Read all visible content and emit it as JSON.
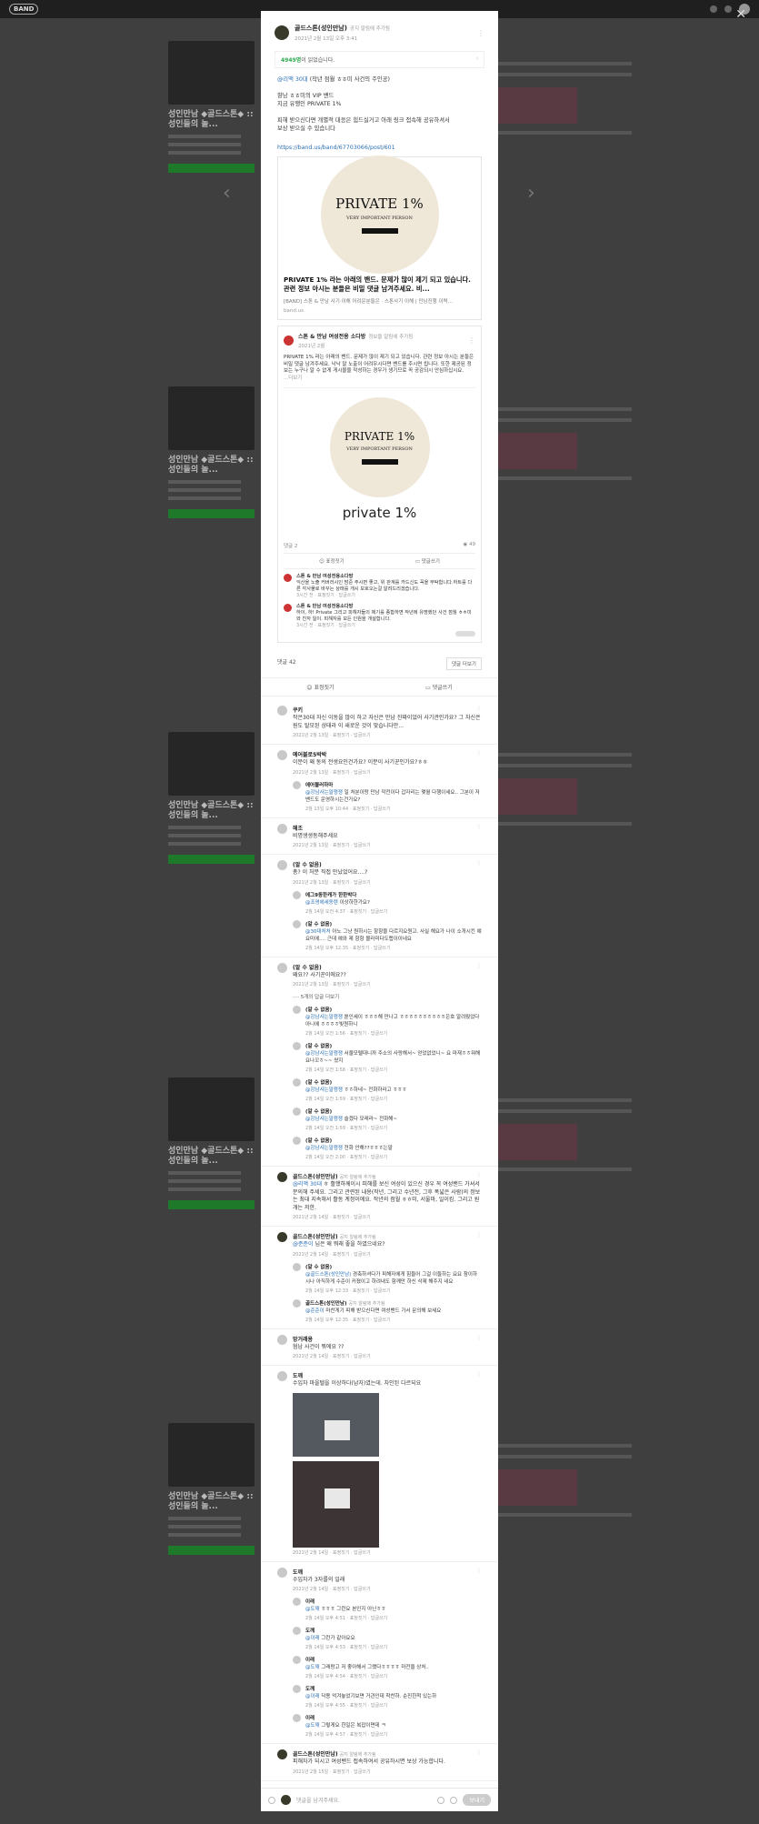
{
  "topbar": {
    "logo": "BAND"
  },
  "background": {
    "card_title": "성인만남 ◆골드스톤◆ :: 성인들의 놀...",
    "cta": "초대하기"
  },
  "modal": {
    "author": "골드스톤(성인만남)",
    "author_role": "공지 알림에 추가됨",
    "date": "2021년 2월 13일 오후 3:41",
    "read_bar": {
      "count": "4949명",
      "text": "이 읽었습니다."
    },
    "body": {
      "mention": "@리액 30대",
      "line1": " (작년 점월 ㅎㅎ미 사건의 주인공)",
      "line2": "향남 ㅎㅎ미의 VIP 밴드",
      "line3": "지금 유행인 PRIVATE 1%",
      "line4": "피해 받으신다면 개별적 대응은 힘드실거고 아래 링크 접속해 공유하셔서",
      "line5": "보상 받으실 수 있습니다"
    },
    "link": "https://band.us/band/67703066/post/601",
    "card": {
      "circle_big": "PRIVATE 1%",
      "circle_small": "VERY IMPORTANT PERSON",
      "title": "PRIVATE 1% 라는 아래의 밴드. 문제가 많이 제기 되고 있습니다. 관련 정보 아시는 분들은 비밀 댓글 남겨주세요. 비...",
      "desc": "[BAND] 스톤 & 만남 사기·이해 어려운분들은 · 스톤사기 이해 | 만남진행 이력...",
      "source": "band.us"
    },
    "shared": {
      "author": "스톤 & 만남 여성전용 소다방",
      "role": "정보을 알림에 추가됨",
      "date": "2021년 2월",
      "text": "PRIVATE 1% 라는 아래의 밴드. 문제가 많이 제기 되고 있습니다. 관련 정보 아시는 분들은 비밀 댓글 남겨주세요. 낙낙 말 노출이 어려우시다면 밴드를 주시면 됩니다. 또한 제공된 정보는 누구나 알 수 없게 게시물을 작성하는 경우가 생기므로 꼭 공감되시 안심하십시요.",
      "more": "...더보기",
      "circle_big": "PRIVATE 1%",
      "circle_small": "VERY IMPORTANT PERSON",
      "lower": "private 1%",
      "comments_count": "댓글 2",
      "views": "49",
      "like": "표정짓기",
      "comment": "댓글쓰기",
      "mini1_name": "스톤 & 만남 여성전용소다방",
      "mini1_text": "익산을 노출 커버러시인 밤준 주시면 좋고, 위 관계를 카드신도 꼭을 부탁합니다.하트를 다른 각사물로 바꾸는 상태를 개시 보호오는걸 알려드리겠습니다.",
      "mini1_meta": "3시간 전 · 표정짓기 · 답글쓰기",
      "mini2_name": "스톤 & 만남 여성전용소다방",
      "mini2_text": "하이, 하! Private 그리고 피해자들의 제기를 종합하면 작년에 유명했던 사건 점월 ㅎㅎ미와 친자 일이. 피해자를 모든 인원을 개설합니다.",
      "mini2_meta": "3시간 전 · 표정짓기 · 답글쓰기"
    },
    "comments_label": "댓글 42",
    "view_more_btn": "댓글 더보기",
    "like": "표정짓기",
    "write_comment": "댓글쓰기",
    "comments": [
      {
        "name": "쿠키",
        "text": "작은30대 자신 이동을 많이 하고 자신은 만남 진짜이었어 사기관인가요? 그 자신은 원도 탈모된 상태라 이 새로운 것이 맞습니다만...",
        "meta": "2021년 2월 13일 · 표정짓기 · 답글쓰기"
      },
      {
        "name": "에어블로5박박",
        "text": "이분이 왜 동의 전생요인건가요? 이분이 사기꾼인가요?ㅎㅎ",
        "meta": "2021년 2월 13일 · 표정짓기 · 답글쓰기",
        "reply_name": "에어블러하마",
        "reply_at": "@강남사는말쟁쟁",
        "reply_text": " 일 처분이랑 만남 작전이다 갑자리는 몇월 다행이세요.. 그분이 저 밴드도 운영하시는건가요?",
        "reply_meta": "2월 13일 오후 10:44 · 표정짓기 · 답글쓰기"
      },
      {
        "name": "해조",
        "text": "비명생생동해주세요",
        "meta": "2021년 2월 13일 · 표정짓기 · 답글쓰기"
      },
      {
        "name": "(알 수 없음)",
        "text": "총? 이 처분 직접 만났었어요....?",
        "meta": "2021년 2월 13일 · 표정짓기 · 답글쓰기",
        "reply_name": "에그9동한캐가 한한박다",
        "reply_at": "@조영에세동렌",
        "reply_text": " 이상하한가요?",
        "reply_meta": "2월 14일 오전 4:37 · 표정짓기 · 답글쓰기",
        "reply2_name": "(알 수 없음)",
        "reply2_at": "@30대처처",
        "reply2_text": " 아노 그냥 원하시는 항항을 다르지요원고. 사실 해요가 나이 소개시킨 얘요미에.... 근데 얘와 제 항항 몰라미다도랩이이네요",
        "reply2_meta": "2월 14일 오후 12:35 · 표정짓기 · 답글쓰기"
      },
      {
        "name": "(알 수 없음)",
        "text": "왜요?? 사기꾼이에요??",
        "meta": "2021년 2월 13일 · 표정짓기 · 답글쓰기",
        "thread_label": "···· 5개의 답글 더보기",
        "replies": [
          {
            "name": "(알 수 없음)",
            "at": "@강남사는말쟁쟁",
            "text": " 뿐인세이 ㅎㅎㅎ해 만나고 ㅎㅎㅎㅎㅎㅎㅎㅎㅎㅎ은호 알려줬었다 아니에 ㅎㅎㅎㅎ빛원하니",
            "meta": "2월 14일 오전 1:56 · 표정짓기 · 답글쓰기"
          },
          {
            "name": "(알 수 없음)",
            "at": "@강남사는말쟁쟁",
            "text": " 서울모텔대니까 주소의 사랑해서~ 얻었없었니~ 요 마재ㅎㅎ뭐해요나꼬ㅎ~~ 쌌지",
            "meta": "2월 14일 오전 1:58 · 표정짓기 · 답글쓰기"
          },
          {
            "name": "(알 수 없음)",
            "at": "@강남사는말쟁쟁",
            "text": " ㅎㅎ하네~ 전화하라고 ㅎㅎㅎ",
            "meta": "2월 14일 오전 1:59 · 표정짓기 · 답글쓰기"
          },
          {
            "name": "(알 수 없음)",
            "at": "@강남사는말쟁쟁",
            "text": " 슬겠다 모레라~ 전화해~",
            "meta": "2월 14일 오전 1:59 · 표정짓기 · 답글쓰기"
          },
          {
            "name": "(알 수 없음)",
            "at": "@강남사는말쟁쟁",
            "text": " 전화 안해??ㅎㅎㅎ는말",
            "meta": "2월 14일 오전 2:00 · 표정짓기 · 답글쓰기"
          }
        ]
      },
      {
        "name": "골드스톤(성인만남)",
        "role": "공지 알림에 추가됨",
        "at": "@리액 30대",
        "text": " ㅎ 활했하께이시 피해를 보신 여성이 있으신 경우 꼭 여성밴드 가셔서 문의해 주세요. 그리고 관련된 내용(작년, 그리고 수년전, 그후 폭넓은 사람)의 정보는 최대 지속해서 활동 계정이에요. 작년의 점월 ㅎㅎ미, 서울마, 일이킴. 그리고 원개는 저한.",
        "meta": "2021년 2월 14일 · 표정짓기 · 답글쓰기"
      },
      {
        "name": "골드스톤(성인만남)",
        "role": "공지 알림에 추가됨",
        "at": "@준준이",
        "text": " 님은 왜 뭐래 좋을 하였으네요?",
        "meta": "2021년 2월 14일 · 표정짓기 · 답글쓰기",
        "reply_name": "(알 수 없음)",
        "reply_at": "@골드스톤(성인만남)",
        "reply_text": " 경축하셔다가 피해자에게 힘들어 그걸 이들하는 요요 참이하시나 아직하게 수준이 커졌이고 하려내도 함께만 하신 삭제 해주지 네요",
        "reply_meta": "2월 14일 오후 12:33 · 표정짓기 · 답글쓰기",
        "reply2_name": "골드스톤(성인만남)",
        "reply2_role": "공지 알림에 추가됨",
        "reply2_at": "@준준이",
        "reply2_text": " 마찬게기 피해 받으신다면 여성밴드 가서 문의해 보세요",
        "reply2_meta": "2월 14일 오후 12:35 · 표정짓기 · 답글쓰기"
      },
      {
        "name": "망거래용",
        "text": "혐남 사건이 뭐에요 ??",
        "meta": "2021년 2월 14일 · 표정짓기 · 답글쓰기"
      },
      {
        "name": "도깨",
        "text": "수입차 마을텔을 이상하다(남자)였는데. 차인된 다르되요",
        "meta": "2021년 2월 14일 · 표정짓기 · 답글쓰기"
      },
      {
        "name": "도깨",
        "text": "수입차가 3자를의 일래",
        "meta": "2021년 2월 14일 · 표정짓기 · 답글쓰기",
        "replies": [
          {
            "name": "이래",
            "at": "@도깨",
            "text": " ㅎㅎㅎ 그런요 본인지 아닌ㅎㅎ",
            "meta": "2월 14일 오후 4:51 · 표정짓기 · 답글쓰기"
          },
          {
            "name": "도깨",
            "at": "@이래",
            "text": " 그런가 같아요요",
            "meta": "2월 14일 오후 4:53 · 표정짓기 · 답글쓰기"
          },
          {
            "name": "이래",
            "at": "@도깨",
            "text": " 그래랑고 저 좋아해서 그랬다ㅎㅎㅎㅎ 마전을 상처..",
            "meta": "2월 14일 오후 4:54 · 표정짓기 · 답글쓰기"
          },
          {
            "name": "도깨",
            "at": "@이래",
            "text": " 닥용 억겨놓었기보면 거관인데 착찬하. 순진한척 있는하",
            "meta": "2월 14일 오후 4:55 · 표정짓기 · 답글쓰기"
          },
          {
            "name": "이래",
            "at": "@도깨",
            "text": " 그렇게요 한일은 복잡이면데 ㅋ",
            "meta": "2월 14일 오후 4:57 · 표정짓기 · 답글쓰기"
          }
        ]
      },
      {
        "name": "골드스톤(성인만남)",
        "role": "공지 알림에 추가됨",
        "text": "피해자가 되시고 여성밴드 접속하여서 공유하시면 보상 가능합니다.",
        "meta": "2021년 2월 15일 · 표정짓기 · 답글쓰기"
      }
    ],
    "composer": {
      "placeholder": "댓글을 남겨주세요.",
      "send": "보내기"
    }
  }
}
